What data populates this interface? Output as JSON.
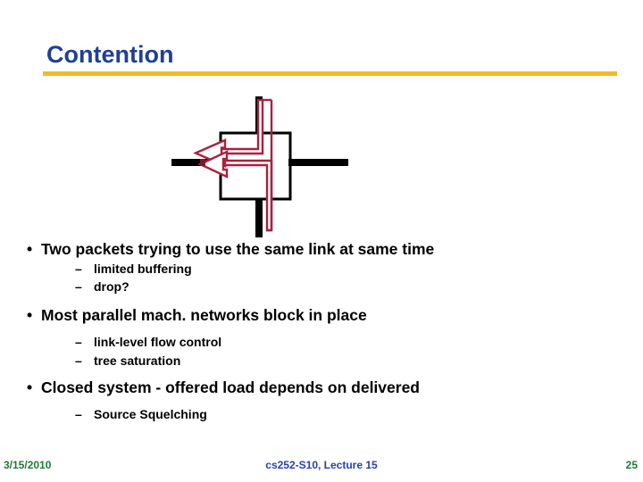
{
  "slide": {
    "title": "Contention",
    "title_color": "#1f3f94",
    "rule_color": "#f0bc28",
    "background": "#ffffff"
  },
  "diagram": {
    "name": "switch-contention-diagram",
    "line_color": "#000000",
    "arrow_color": "#a9223f",
    "arrow_fill": "#ffffff",
    "box_label": "",
    "parts": [
      "horizontal-link-line",
      "vertical-link-line",
      "switch-box",
      "packet-path-upper",
      "packet-path-lower",
      "arrowhead-upper",
      "arrowhead-lower"
    ]
  },
  "body": {
    "bullets": [
      {
        "level": 1,
        "marker": "•",
        "text": "Two packets trying to use the same link at same time"
      },
      {
        "level": 2,
        "marker": "–",
        "text": "limited buffering"
      },
      {
        "level": 2,
        "marker": "–",
        "text": "drop?"
      },
      {
        "level": 1,
        "marker": "•",
        "text": "Most parallel mach. networks block in place"
      },
      {
        "level": 2,
        "marker": "–",
        "text": "link-level flow control"
      },
      {
        "level": 2,
        "marker": "–",
        "text": "tree saturation"
      },
      {
        "level": 1,
        "marker": "•",
        "text": "Closed system - offered load depends on delivered"
      },
      {
        "level": 2,
        "marker": "–",
        "text": "Source Squelching"
      }
    ]
  },
  "footer": {
    "date": "3/15/2010",
    "center": "cs252-S10, Lecture 15",
    "page": "25",
    "date_color": "#1e7a35",
    "center_color": "#2a3fb0",
    "page_color": "#1e7a35"
  }
}
